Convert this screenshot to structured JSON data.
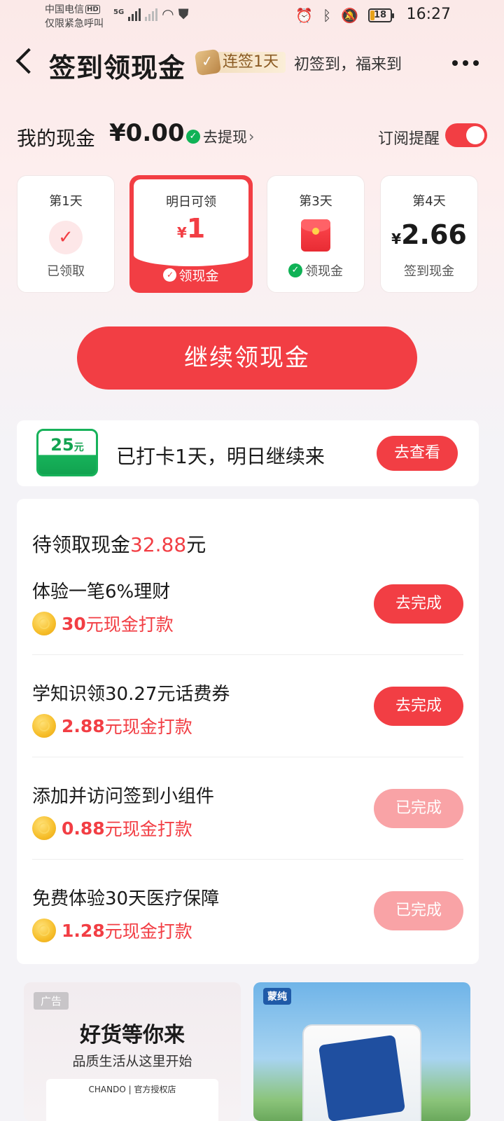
{
  "status_bar": {
    "carrier_line1": "中国电信",
    "hd": "HD",
    "carrier_line2": "仅限紧急呼叫",
    "network": "5G",
    "battery": "18",
    "time": "16:27"
  },
  "header": {
    "title": "签到领现金",
    "streak_label": "连签1天",
    "slogan": "初签到，福来到"
  },
  "cash": {
    "label": "我的现金",
    "amount": "¥0.00",
    "withdraw_label": "去提现",
    "subscribe_label": "订阅提醒",
    "subscribe_on": true
  },
  "days": [
    {
      "title": "第1天",
      "bottom": "已领取"
    },
    {
      "title": "明日可领",
      "currency": "¥",
      "amount": "1",
      "bottom": "领现金"
    },
    {
      "title": "第3天",
      "bottom": "领现金"
    },
    {
      "title": "第4天",
      "currency": "¥",
      "amount": "2.66",
      "bottom": "签到现金"
    }
  ],
  "continue_button": "继续领现金",
  "banner": {
    "coupon_amount": "25",
    "coupon_unit": "元",
    "text": "已打卡1天，明日继续来",
    "button": "去查看"
  },
  "tasks": {
    "head_prefix": "待领取现金",
    "head_amount": "32.88",
    "head_suffix": "元",
    "items": [
      {
        "title": "体验一笔6%理财",
        "reward_amount": "30",
        "reward_suffix": "元现金打款",
        "button": "去完成",
        "done": false
      },
      {
        "title": "学知识领30.27元话费券",
        "reward_amount": "2.88",
        "reward_suffix": "元现金打款",
        "button": "去完成",
        "done": false
      },
      {
        "title": "添加并访问签到小组件",
        "reward_amount": "0.88",
        "reward_suffix": "元现金打款",
        "button": "已完成",
        "done": true
      },
      {
        "title": "免费体验30天医疗保障",
        "reward_amount": "1.28",
        "reward_suffix": "元现金打款",
        "button": "已完成",
        "done": true
      }
    ]
  },
  "ads": {
    "tag": "广告",
    "left_title": "好货等你来",
    "left_sub": "品质生活从这里开始",
    "left_store": "CHANDO | 官方授权店",
    "right_brand": "蒙纯"
  },
  "colors": {
    "accent": "#f23e44",
    "accent_light": "#f9a3a6",
    "green": "#10b256"
  }
}
